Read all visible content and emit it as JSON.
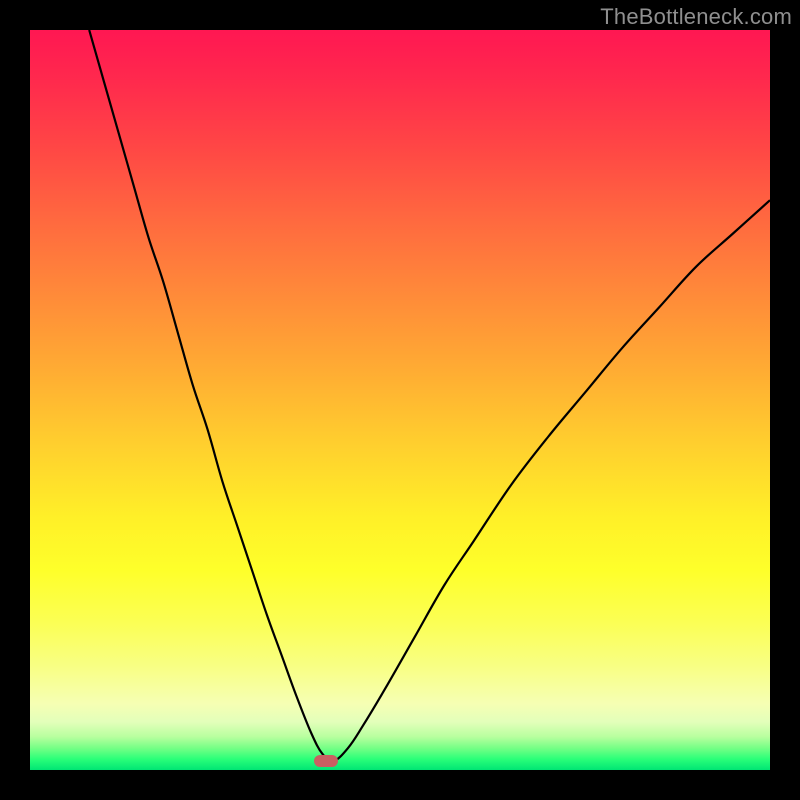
{
  "watermark": "TheBottleneck.com",
  "chart_data": {
    "type": "line",
    "title": "",
    "xlabel": "",
    "ylabel": "",
    "xlim": [
      0,
      100
    ],
    "ylim": [
      0,
      100
    ],
    "background_gradient": {
      "top_color": "#ff1752",
      "mid_color": "#fff028",
      "bottom_color": "#00e574"
    },
    "series": [
      {
        "name": "curve",
        "x": [
          8,
          10,
          12,
          14,
          16,
          18,
          20,
          22,
          24,
          26,
          28,
          30,
          32,
          34,
          36,
          38,
          39.5,
          41,
          43,
          45,
          48,
          52,
          56,
          60,
          65,
          70,
          75,
          80,
          85,
          90,
          95,
          100
        ],
        "y": [
          100,
          93,
          86,
          79,
          72,
          66,
          59,
          52,
          46,
          39,
          33,
          27,
          21,
          15.5,
          10,
          5,
          2.2,
          1.2,
          3,
          6,
          11,
          18,
          25,
          31,
          38.5,
          45,
          51,
          57,
          62.5,
          68,
          72.5,
          77
        ],
        "stroke": "#000000",
        "stroke_width": 2.2
      }
    ],
    "marker": {
      "x": 40,
      "y": 1.2,
      "color": "#c96062"
    }
  }
}
